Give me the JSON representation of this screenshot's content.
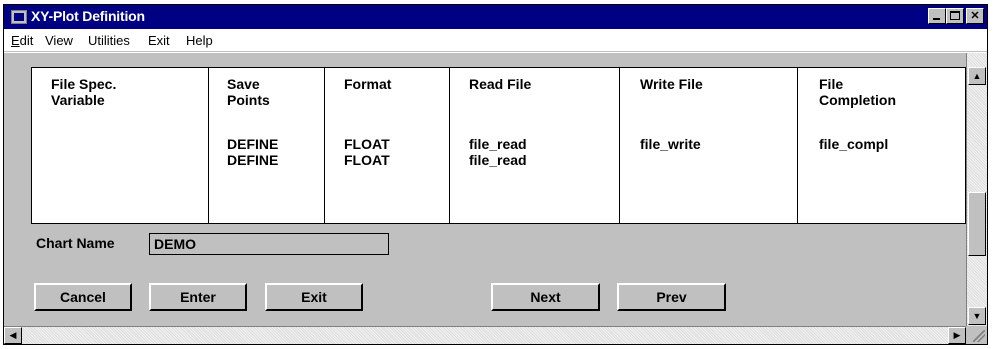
{
  "window": {
    "title": "XY-Plot Definition"
  },
  "menu": {
    "edit": {
      "prefix": "E",
      "accel": "",
      "rest": "dit",
      "underline_first": true
    },
    "view": {
      "label": "View"
    },
    "utilities": {
      "label": "Utilities"
    },
    "exit": {
      "label": "Exit"
    },
    "help": {
      "label": "Help"
    }
  },
  "table": {
    "columns": [
      {
        "header": "File Spec.\nVariable",
        "rows": ""
      },
      {
        "header": "Save\nPoints",
        "rows": "DEFINE\nDEFINE"
      },
      {
        "header": "Format",
        "rows": "FLOAT\nFLOAT"
      },
      {
        "header": "Read File",
        "rows": "file_read\nfile_read"
      },
      {
        "header": "Write File",
        "rows": "file_write"
      },
      {
        "header": "File\nCompletion",
        "rows": "file_compl"
      }
    ]
  },
  "chart_name": {
    "label": "Chart Name",
    "value": "DEMO"
  },
  "buttons": {
    "cancel": "Cancel",
    "enter": "Enter",
    "exit": "Exit",
    "next": "Next",
    "prev": "Prev"
  },
  "icons": {
    "app": "window-app-icon",
    "minimize": "minimize-icon",
    "maximize": "maximize-icon",
    "close": "close-icon",
    "scroll_up": "scroll-up-arrow-icon",
    "scroll_down": "scroll-down-arrow-icon",
    "scroll_left": "scroll-left-arrow-icon",
    "scroll_right": "scroll-right-arrow-icon"
  },
  "colors": {
    "titlebar": "#000082",
    "face": "#c0c0c0"
  }
}
